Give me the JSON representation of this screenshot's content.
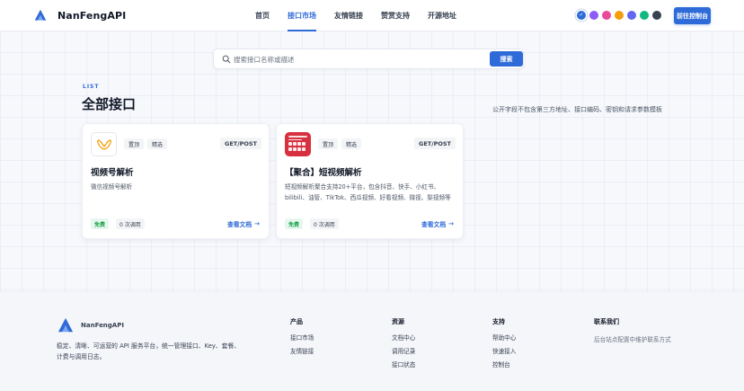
{
  "header": {
    "brand": "NanFengAPI",
    "nav": [
      {
        "label": "首页",
        "active": false
      },
      {
        "label": "接口市场",
        "active": true
      },
      {
        "label": "友情链接",
        "active": false
      },
      {
        "label": "赞赏支持",
        "active": false
      },
      {
        "label": "开源地址",
        "active": false
      }
    ],
    "theme_colors": [
      "#2f6bd8",
      "#8b5cf6",
      "#ec4899",
      "#f59e0b",
      "#6366f1",
      "#10b981",
      "#374151"
    ],
    "console_button": "前往控制台"
  },
  "search": {
    "placeholder": "搜索接口名称或描述",
    "button": "搜索"
  },
  "section": {
    "eyebrow": "LIST",
    "title": "全部接口",
    "notice": "公开字段不包含第三方地址、接口编码、密钥和请求参数模板"
  },
  "cards": [
    {
      "tags": [
        "置顶",
        "精选"
      ],
      "method": "GET/POST",
      "title": "视频号解析",
      "description": "微信视频号解析",
      "price": "免费",
      "calls": "0 次调用",
      "doc_link": "查看文档"
    },
    {
      "tags": [
        "置顶",
        "精选"
      ],
      "method": "GET/POST",
      "title": "【聚合】短视频解析",
      "description": "短视频解析聚合支持20+平台，包含抖音、快手、小红书、bilibili、油管、TikTok、西瓜视频、好看视频、微视、梨视频等",
      "price": "免费",
      "calls": "0 次调用",
      "doc_link": "查看文档"
    }
  ],
  "footer": {
    "brand": "NanFengAPI",
    "description": "稳定、清晰、可运营的 API 服务平台，统一管理接口、Key、套餐、计费与调用日志。",
    "columns": [
      {
        "title": "产品",
        "links": [
          "接口市场",
          "友情链接"
        ]
      },
      {
        "title": "资源",
        "links": [
          "文档中心",
          "调用记录",
          "接口状态"
        ]
      },
      {
        "title": "支持",
        "links": [
          "帮助中心",
          "快速接入",
          "控制台"
        ]
      }
    ],
    "contact": {
      "title": "联系我们",
      "text": "后台站点配置中维护联系方式"
    }
  }
}
